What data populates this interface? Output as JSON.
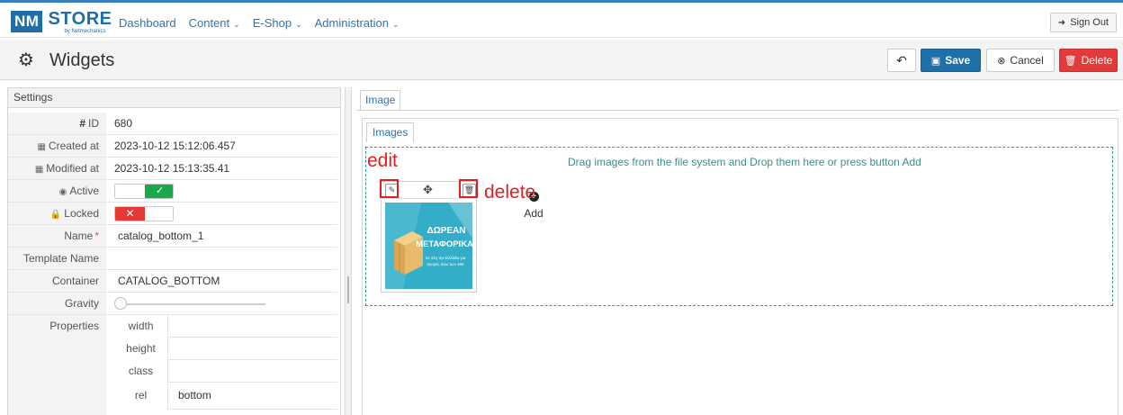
{
  "brand": {
    "logo_nm": "NM",
    "logo_store": "STORE",
    "logo_tagline": "by Netmechanics"
  },
  "nav": {
    "items": [
      {
        "label": "Dashboard",
        "has_dropdown": false
      },
      {
        "label": "Content",
        "has_dropdown": true
      },
      {
        "label": "E-Shop",
        "has_dropdown": true
      },
      {
        "label": "Administration",
        "has_dropdown": true
      }
    ],
    "sign_out": "Sign Out"
  },
  "page": {
    "title": "Widgets",
    "icon": "gears-icon"
  },
  "toolbar": {
    "save": "Save",
    "cancel": "Cancel",
    "delete": "Delete"
  },
  "settings": {
    "header": "Settings",
    "id_label": "ID",
    "id_value": "680",
    "created_label": "Created at",
    "created_value": "2023-10-12 15:12:06.457",
    "modified_label": "Modified at",
    "modified_value": "2023-10-12 15:13:35.41",
    "active_label": "Active",
    "active_on": true,
    "locked_label": "Locked",
    "locked_on": false,
    "name_label": "Name",
    "name_value": "catalog_bottom_1",
    "template_label": "Template Name",
    "template_value": "",
    "container_label": "Container",
    "container_value": "CATALOG_BOTTOM",
    "gravity_label": "Gravity",
    "properties_label": "Properties",
    "properties": [
      {
        "key": "width",
        "value": ""
      },
      {
        "key": "height",
        "value": ""
      },
      {
        "key": "class",
        "value": ""
      },
      {
        "key": "rel",
        "value": "bottom"
      }
    ]
  },
  "content_panel": {
    "outer_tab": "Image",
    "inner_tab": "Images",
    "drop_hint": "Drag images from the file system and Drop them here or press button Add",
    "add_label": "Add",
    "image": {
      "line1": "ΔΩΡΕΑΝ",
      "line2": "ΜΕΤΑΦΟΡΙΚΑ",
      "line3": "σε όλη την Ελλάδα για",
      "line4": "αγορές άνω των 40€"
    }
  },
  "annotations": {
    "edit": "edit",
    "delete": "delete"
  },
  "colors": {
    "primary": "#1f6fa8",
    "danger": "#e33b3b",
    "success": "#19a94b",
    "annotation": "#e02020",
    "dropzone": "#2f9a8a"
  }
}
